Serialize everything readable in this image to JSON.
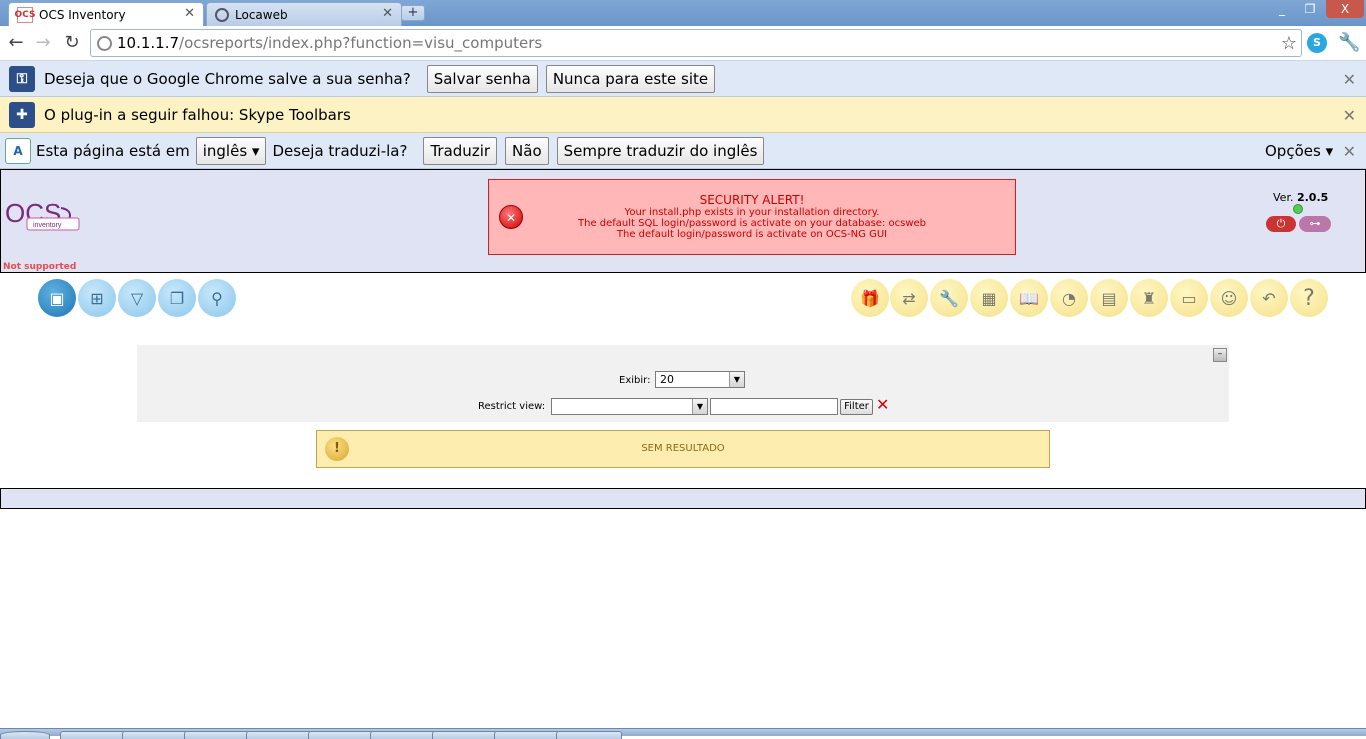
{
  "browser": {
    "tabs": [
      {
        "title": "OCS Inventory",
        "favicon": "OCS",
        "active": true
      },
      {
        "title": "Locaweb",
        "favicon": "globe-icon",
        "active": false
      }
    ],
    "new_tab_label": "+",
    "window_controls": [
      "_",
      "❐",
      "X"
    ],
    "address": {
      "host": "10.1.1.7",
      "path": "/ocsreports/index.php?function=visu_computers"
    }
  },
  "infobars": {
    "password": {
      "text": "Deseja que o Google Chrome salve a sua senha?",
      "save_label": "Salvar senha",
      "never_label": "Nunca para este site"
    },
    "plugin": {
      "text": "O plug-in a seguir falhou: Skype Toolbars"
    },
    "translate": {
      "prefix": "Esta página está em",
      "language": "inglês",
      "question": "Deseja traduzi-la?",
      "translate_label": "Traduzir",
      "no_label": "Não",
      "always_label": "Sempre traduzir do inglês",
      "options_label": "Opções"
    }
  },
  "ocs": {
    "not_supported": "Not supported",
    "alert": {
      "title": "SECURITY ALERT!",
      "lines": [
        "Your install.php exists in your installation directory.",
        "The default SQL login/password is activate on your database: ocsweb",
        "The default login/password is activate on OCS-NG GUI"
      ]
    },
    "version_label": "Ver.",
    "version_number": "2.0.5",
    "filter": {
      "show_label": "Exibir:",
      "show_value": "20",
      "restrict_label": "Restrict view:",
      "restrict_value": "",
      "filter_text": "",
      "filter_button": "Filter"
    },
    "no_result": "SEM RESULTADO"
  },
  "icons": {
    "left_nav": [
      "computers-icon",
      "network-icon",
      "filter-icon",
      "groups-icon",
      "search-icon"
    ],
    "right_nav": [
      "deploy-icon",
      "transfer-icon",
      "configuration-icon",
      "registry-icon",
      "dictionary-icon",
      "statistics-icon",
      "documents-icon",
      "duplicates-icon",
      "devices-icon",
      "users-icon",
      "restore-icon",
      "help-icon"
    ]
  },
  "colors": {
    "header_bg": "#dfe3f4",
    "alert_bg": "#ffb7b7",
    "alert_text": "#cc0000",
    "noresult_bg": "#fdedae",
    "password_bar": "#dfe8f6",
    "plugin_bar": "#fdf2c4",
    "translate_bar": "#dfe8f6"
  }
}
